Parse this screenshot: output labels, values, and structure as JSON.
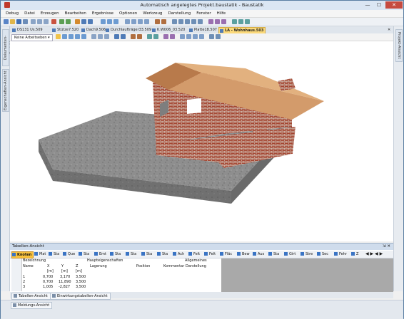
{
  "window": {
    "title": "Automatisch angelegtes Projekt.baustatik - Baustatik",
    "minimize": "—",
    "maximize": "☐",
    "close": "✕"
  },
  "menu": [
    "Debug",
    "Datei",
    "Erzeugen",
    "Bearbeiten",
    "Ergebnisse",
    "Optionen",
    "Werkzeug",
    "Darstellung",
    "Fenster",
    "Hilfe"
  ],
  "left_tabs": [
    "Dokumenten-Ansicht",
    "Eigenschaften-Ansicht"
  ],
  "right_tabs": [
    "Projekt-Ansicht"
  ],
  "doc_tabs": [
    "DS131 Us.509",
    "Stütze7.520",
    "Dach9.506",
    "Durchlaufträger33.509",
    "K.W006_03.520",
    "Platte18.507",
    "LA - Wohnhaus.503"
  ],
  "view": {
    "layer_combo": "Keine Arbeitseben ▾"
  },
  "panel": {
    "title": "Tabellen-Ansicht",
    "pin": "⇲ ✕",
    "tabs": [
      "Knoten",
      "Mat",
      "Sta",
      "Que",
      "Sta",
      "Emt",
      "Sta",
      "Sta",
      "Sta",
      "Sta",
      "Ach",
      "Felt",
      "Felt",
      "Fläc",
      "Bew",
      "Aus",
      "Sta",
      "Girt",
      "Stre",
      "Sec",
      "Fehr",
      "Z"
    ],
    "group_headers": [
      "Haupteigenschaften",
      "Allgemeines"
    ],
    "columns": [
      "Bezeichnung",
      "Name",
      "X",
      "Y",
      "Z",
      "Lagerung",
      "Position",
      "Kommentar",
      "Darstellung"
    ],
    "units": [
      "[m]",
      "[m]",
      "[m]"
    ],
    "rows": [
      {
        "name": "1",
        "x": "0,700",
        "y": "3,170",
        "z": "3,500"
      },
      {
        "name": "2",
        "x": "0,700",
        "y": "11,890",
        "z": "3,500"
      },
      {
        "name": "3",
        "x": "1,005",
        "y": "-2,827",
        "z": "3,500"
      }
    ]
  },
  "bottom_tabs": [
    "Tabellen-Ansicht",
    "Einwirkungstabellen-Ansicht"
  ],
  "status_tabs": [
    "Meldungs-Ansicht"
  ],
  "colors": {
    "accent": "#f9c23c",
    "title_bg": "#dbe6f3",
    "roof": "#d39b6b",
    "brick": "#a3432f",
    "concrete": "#8b8b8b"
  }
}
